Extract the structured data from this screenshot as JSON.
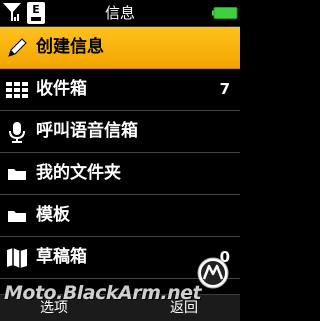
{
  "header": {
    "title": "信息",
    "network_label": "E"
  },
  "menu": {
    "items": [
      {
        "label": "创建信息",
        "icon": "pencil-icon",
        "selected": true
      },
      {
        "label": "收件箱",
        "icon": "grid-icon",
        "count": "7"
      },
      {
        "label": "呼叫语音信箱",
        "icon": "microphone-icon"
      },
      {
        "label": "我的文件夹",
        "icon": "folder-icon"
      },
      {
        "label": "模板",
        "icon": "folder-icon"
      },
      {
        "label": "草稿箱",
        "icon": "draft-icon",
        "count": "0"
      }
    ]
  },
  "softkeys": {
    "left": "选项",
    "right": "返回"
  },
  "watermark": "Moto.BlackArm.net",
  "colors": {
    "selected_bg": "#f9b20c",
    "battery": "#3fcf3f",
    "background": "#000000"
  }
}
